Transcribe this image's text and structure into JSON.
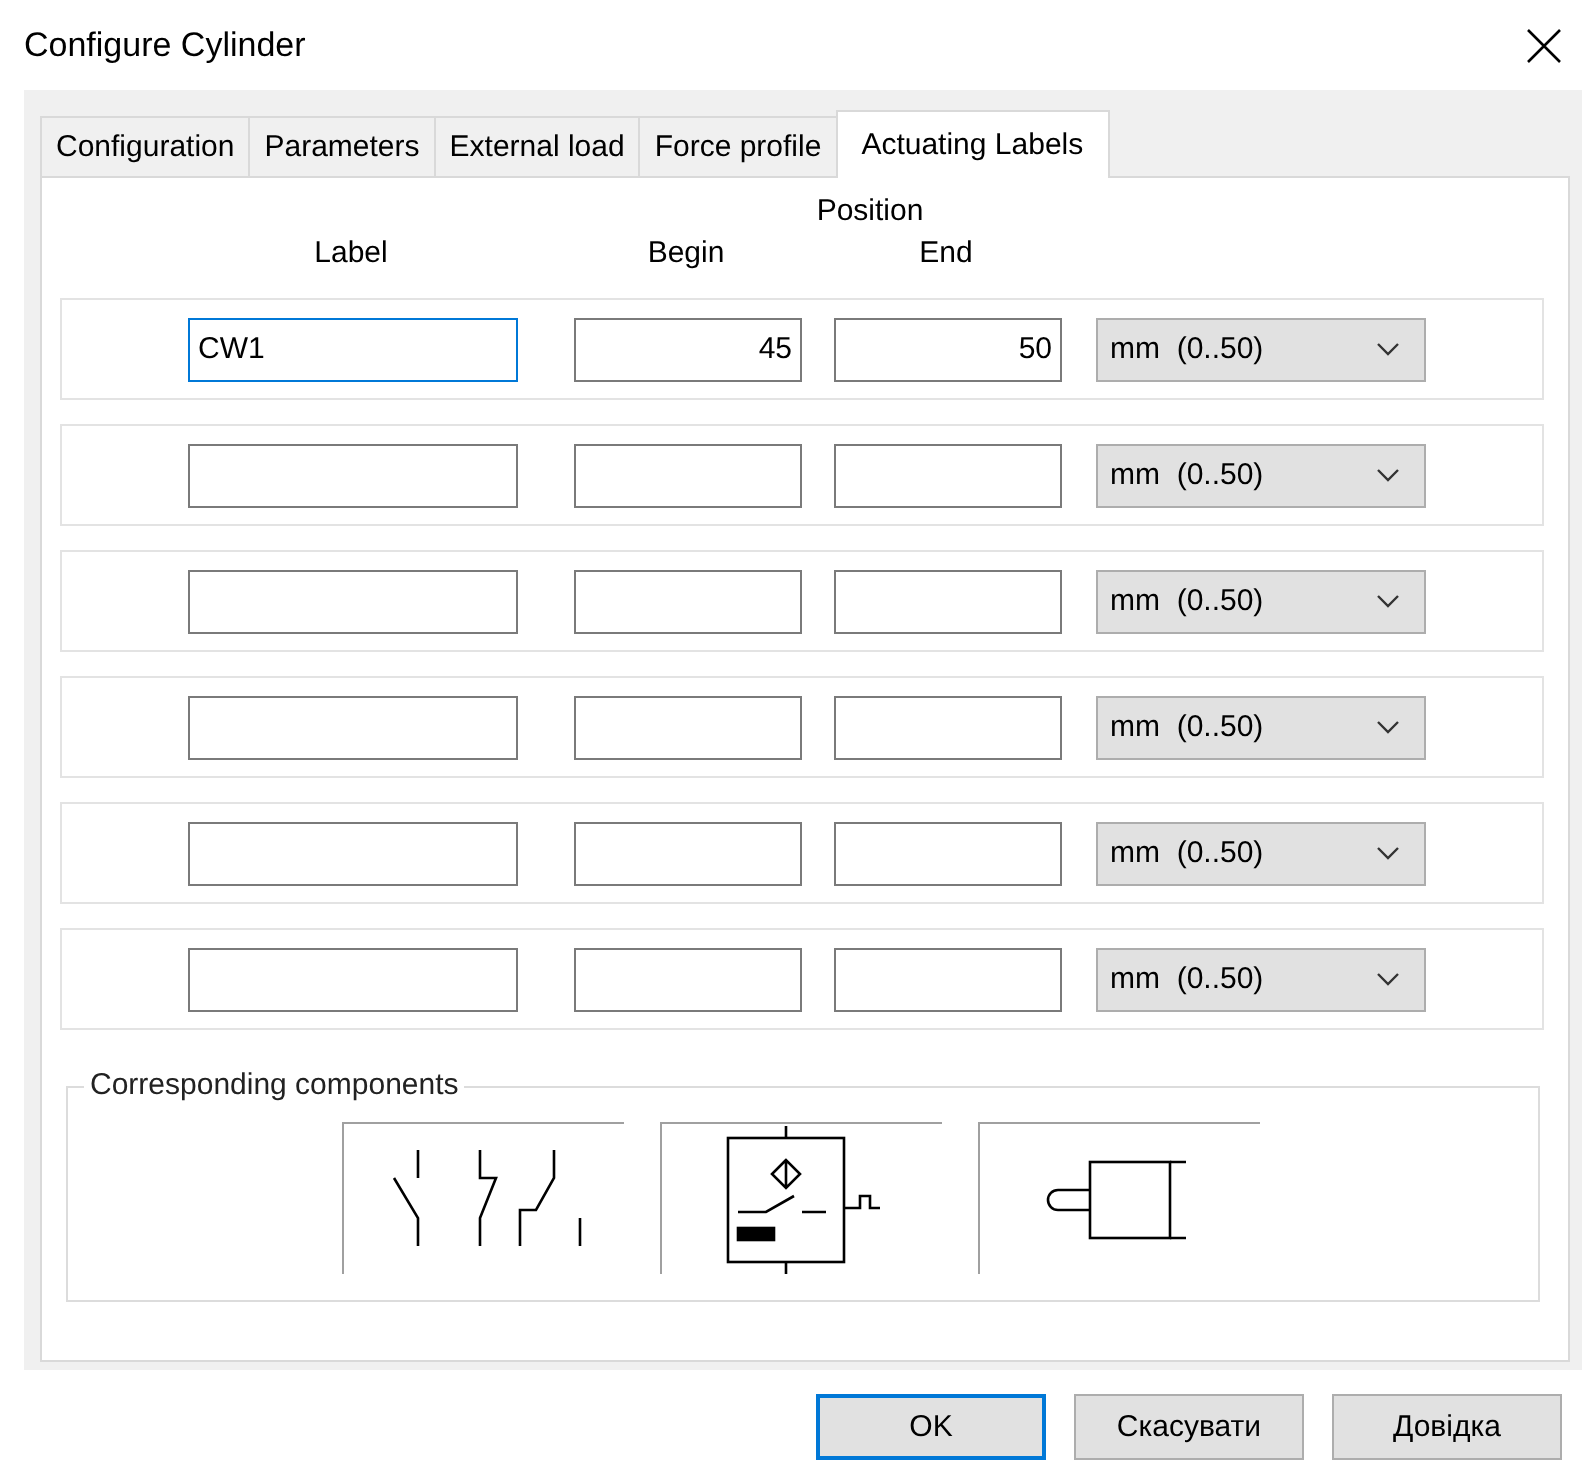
{
  "window": {
    "title": "Configure Cylinder"
  },
  "tabs": [
    {
      "label": "Configuration",
      "selected": false
    },
    {
      "label": "Parameters",
      "selected": false
    },
    {
      "label": "External load",
      "selected": false
    },
    {
      "label": "Force profile",
      "selected": false
    },
    {
      "label": "Actuating Labels",
      "selected": true
    }
  ],
  "headers": {
    "group": "Position",
    "label": "Label",
    "begin": "Begin",
    "end": "End"
  },
  "rows": [
    {
      "label": "CW1",
      "begin": "45",
      "end": "50",
      "unit": "mm  (0..50)",
      "focused": true
    },
    {
      "unit": "mm  (0..50)",
      "focused": false
    },
    {
      "unit": "mm  (0..50)",
      "focused": false
    },
    {
      "unit": "mm  (0..50)",
      "focused": false
    },
    {
      "unit": "mm  (0..50)",
      "focused": false
    },
    {
      "unit": "mm  (0..50)",
      "focused": false
    }
  ],
  "components": {
    "title": "Corresponding components",
    "items": [
      {
        "kind": "contacts"
      },
      {
        "kind": "sensor"
      },
      {
        "kind": "cam"
      }
    ]
  },
  "buttons": [
    {
      "label": "OK",
      "default": true
    },
    {
      "label": "Скасувати",
      "default": false
    },
    {
      "label": "Довідка",
      "default": false
    }
  ]
}
